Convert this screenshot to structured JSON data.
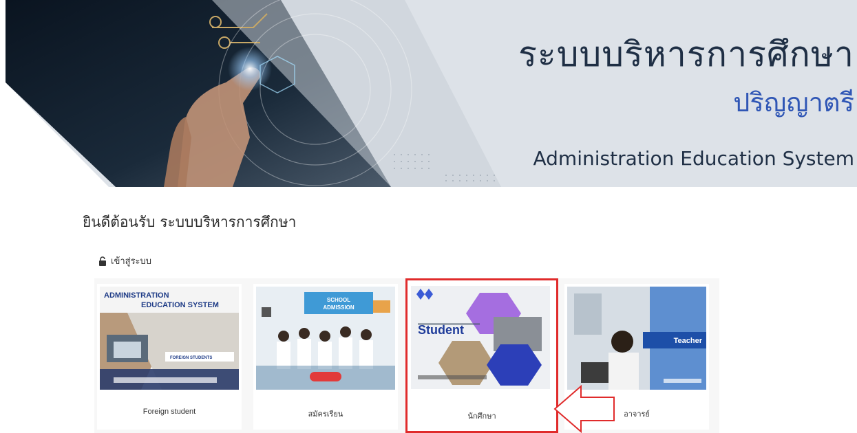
{
  "banner": {
    "title_th": "ระบบบริหารการศึกษา",
    "subtitle_th": "ปริญญาตรี",
    "title_en": "Administration Education System"
  },
  "welcome": {
    "text": "ยินดีต้อนรับ ระบบบริหารการศึกษา",
    "login_label": "เข้าสู่ระบบ"
  },
  "cards": [
    {
      "thumb_title_1": "ADMINISTRATION",
      "thumb_title_2": "EDUCATION SYSTEM",
      "thumb_tag": "FOREIGN STUDENTS",
      "label": "Foreign student"
    },
    {
      "thumb_title_1": "SCHOOL",
      "thumb_title_2": "ADMISSION",
      "label": "สมัครเรียน"
    },
    {
      "thumb_title": "Student",
      "label": "นักศึกษา",
      "selected": true
    },
    {
      "thumb_title": "Teacher",
      "label": "อาจารย์"
    }
  ],
  "colors": {
    "accent_blue": "#2f56b5",
    "highlight_red": "#e02b2b",
    "banner_bg": "#dde2e8"
  }
}
